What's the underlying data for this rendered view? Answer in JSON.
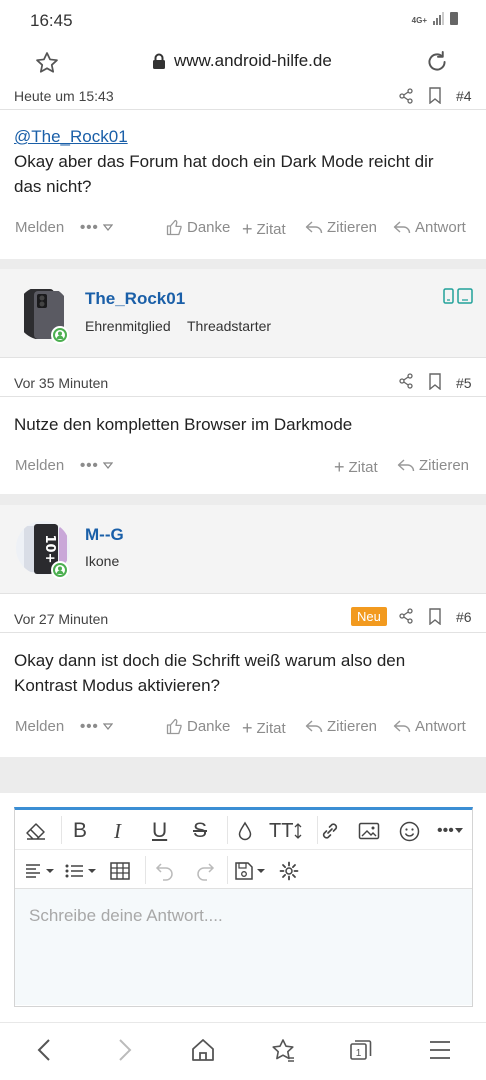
{
  "status": {
    "time": "16:45",
    "network": "4G+"
  },
  "browser": {
    "url": "www.android-hilfe.de"
  },
  "posts": [
    {
      "time": "Heute um 15:43",
      "number": "#4",
      "mention": "@The_Rock01",
      "text": "Okay aber das Forum hat doch ein Dark Mode reicht dir das nicht?",
      "actions": {
        "report": "Melden",
        "like": "Danke",
        "quote": "Zitat",
        "reply_quote": "Zitieren",
        "reply": "Antwort"
      }
    },
    {
      "author": "The_Rock01",
      "rank": "Ehrenmitglied",
      "badge": "Threadstarter",
      "time": "Vor 35 Minuten",
      "number": "#5",
      "text": "Nutze den kompletten Browser im Darkmode",
      "actions": {
        "report": "Melden",
        "quote": "Zitat",
        "reply_quote": "Zitieren"
      }
    },
    {
      "author": "M--G",
      "rank": "Ikone",
      "time": "Vor 27 Minuten",
      "new_label": "Neu",
      "number": "#6",
      "text": "Okay dann ist doch die Schrift weiß warum also den Kontrast Modus aktivieren?",
      "actions": {
        "report": "Melden",
        "like": "Danke",
        "quote": "Zitat",
        "reply_quote": "Zitieren",
        "reply": "Antwort"
      }
    }
  ],
  "editor": {
    "placeholder": "Schreibe deine Antwort...."
  },
  "colors": {
    "link": "#1a5fa8",
    "accent": "#3b8ed4",
    "new_badge": "#f29a1f",
    "online": "#4caf50"
  }
}
